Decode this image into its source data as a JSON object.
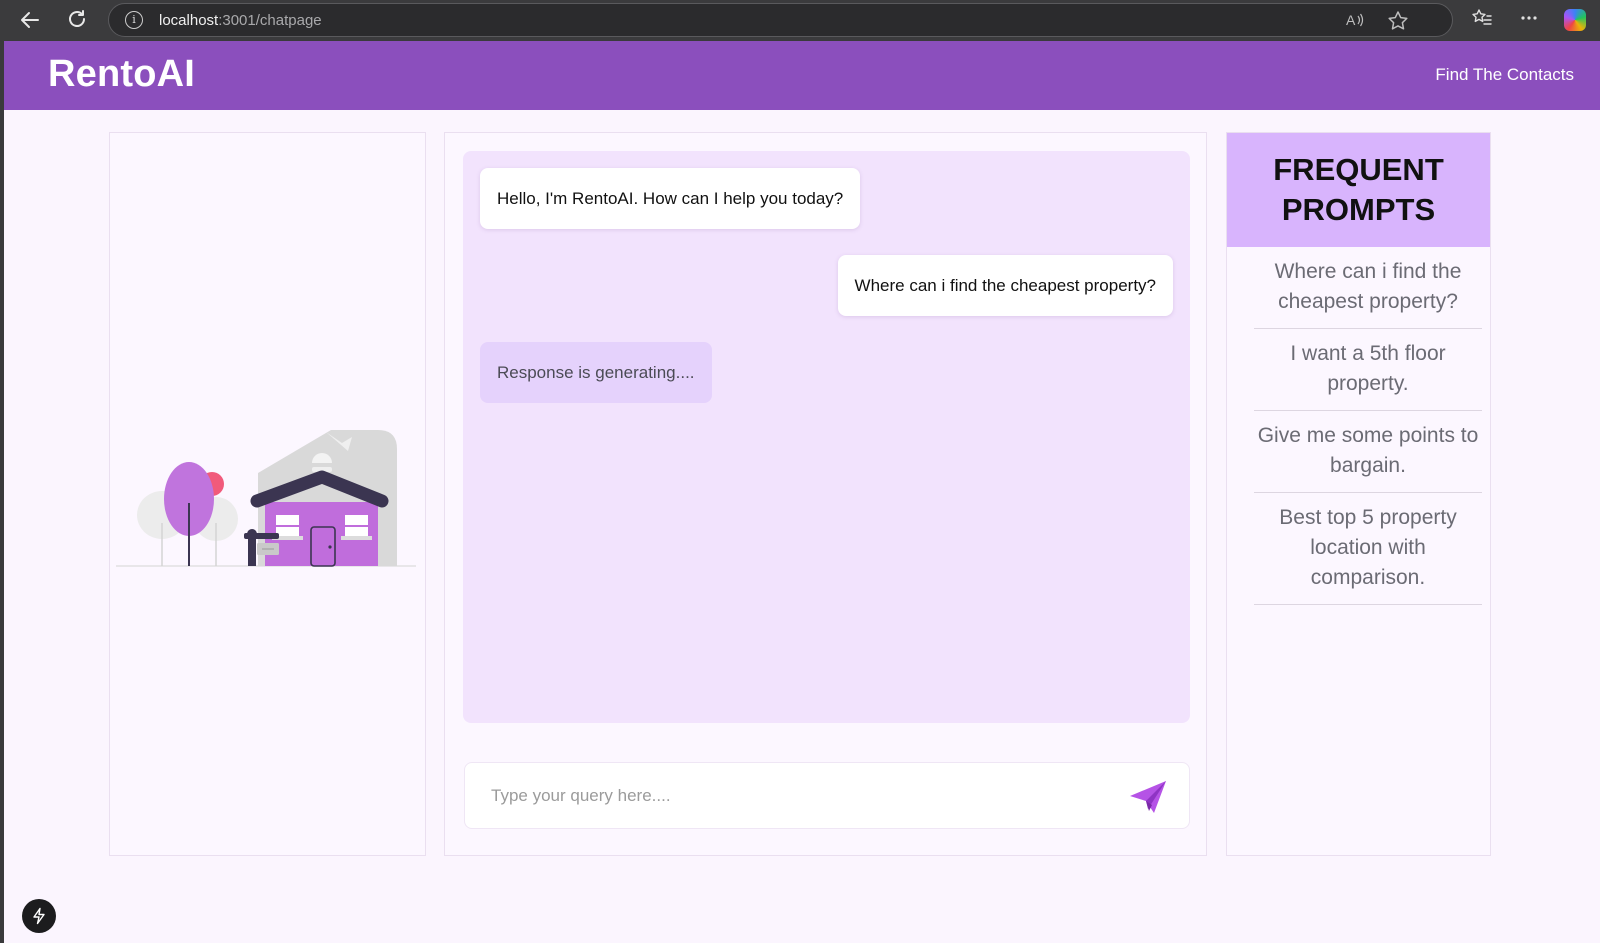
{
  "browser": {
    "back_icon": "back-arrow-icon",
    "reload_icon": "reload-icon",
    "url_host": "localhost",
    "url_path": ":3001/chatpage",
    "read_aloud_icon": "read-aloud-icon",
    "favorite_icon": "star-icon",
    "favorites_icon": "favorites-icon",
    "menu_icon": "more-icon",
    "copilot_icon": "copilot-icon"
  },
  "header": {
    "brand": "RentoAI",
    "link": "Find The Contacts",
    "color": "#8b4fbd"
  },
  "chat": {
    "messages": [
      {
        "role": "bot",
        "text": "Hello, I'm RentoAI. How can I help you today?"
      },
      {
        "role": "user",
        "text": "Where can i find the cheapest property?"
      },
      {
        "role": "pending",
        "text": "Response is generating...."
      }
    ],
    "input_placeholder": "Type your query here....",
    "input_value": "",
    "send_icon": "send-paper-plane-icon",
    "accent": "#a855f7"
  },
  "sidebar": {
    "title_line1": "FREQUENT",
    "title_line2": "PROMPTS",
    "prompts": [
      "Where can i find the cheapest property?",
      "I want a 5th floor property.",
      "Give me some points to bargain.",
      "Best top 5 property location with comparison."
    ]
  }
}
